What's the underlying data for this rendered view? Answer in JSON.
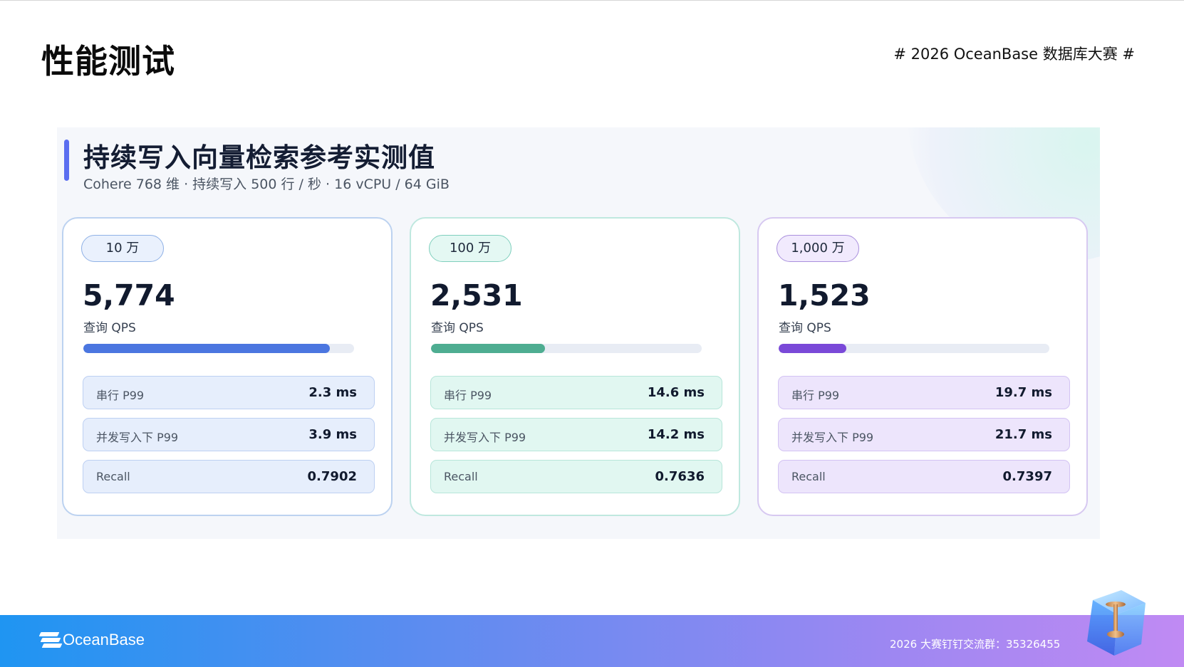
{
  "header": {
    "title": "性能测试",
    "event_tag": "# 2026 OceanBase 数据库大赛 #"
  },
  "panel": {
    "title": "持续写入向量检索参考实测值",
    "subtitle": "Cohere 768 维 · 持续写入 500 行 / 秒 · 16 vCPU / 64 GiB",
    "cards": [
      {
        "badge": "10 万",
        "value": "5,774",
        "value_label": "查询 QPS",
        "bar_fraction": 0.91,
        "accent_color": "#4b76e0",
        "metrics": [
          {
            "label": "串行 P99",
            "value": "2.3 ms"
          },
          {
            "label": "并发写入下 P99",
            "value": "3.9 ms"
          },
          {
            "label": "Recall",
            "value": "0.7902"
          }
        ]
      },
      {
        "badge": "100 万",
        "value": "2,531",
        "value_label": "查询 QPS",
        "bar_fraction": 0.42,
        "accent_color": "#4ead91",
        "metrics": [
          {
            "label": "串行 P99",
            "value": "14.6 ms"
          },
          {
            "label": "并发写入下 P99",
            "value": "14.2 ms"
          },
          {
            "label": "Recall",
            "value": "0.7636"
          }
        ]
      },
      {
        "badge": "1,000 万",
        "value": "1,523",
        "value_label": "查询 QPS",
        "bar_fraction": 0.25,
        "accent_color": "#7a49d8",
        "metrics": [
          {
            "label": "串行 P99",
            "value": "19.7 ms"
          },
          {
            "label": "并发写入下 P99",
            "value": "21.7 ms"
          },
          {
            "label": "Recall",
            "value": "0.7397"
          }
        ]
      }
    ]
  },
  "footer": {
    "logo_text": "OceanBase",
    "group_text": "2026 大赛钉钉交流群：35326455",
    "decoration_icon": "trophy-cube-icon"
  }
}
